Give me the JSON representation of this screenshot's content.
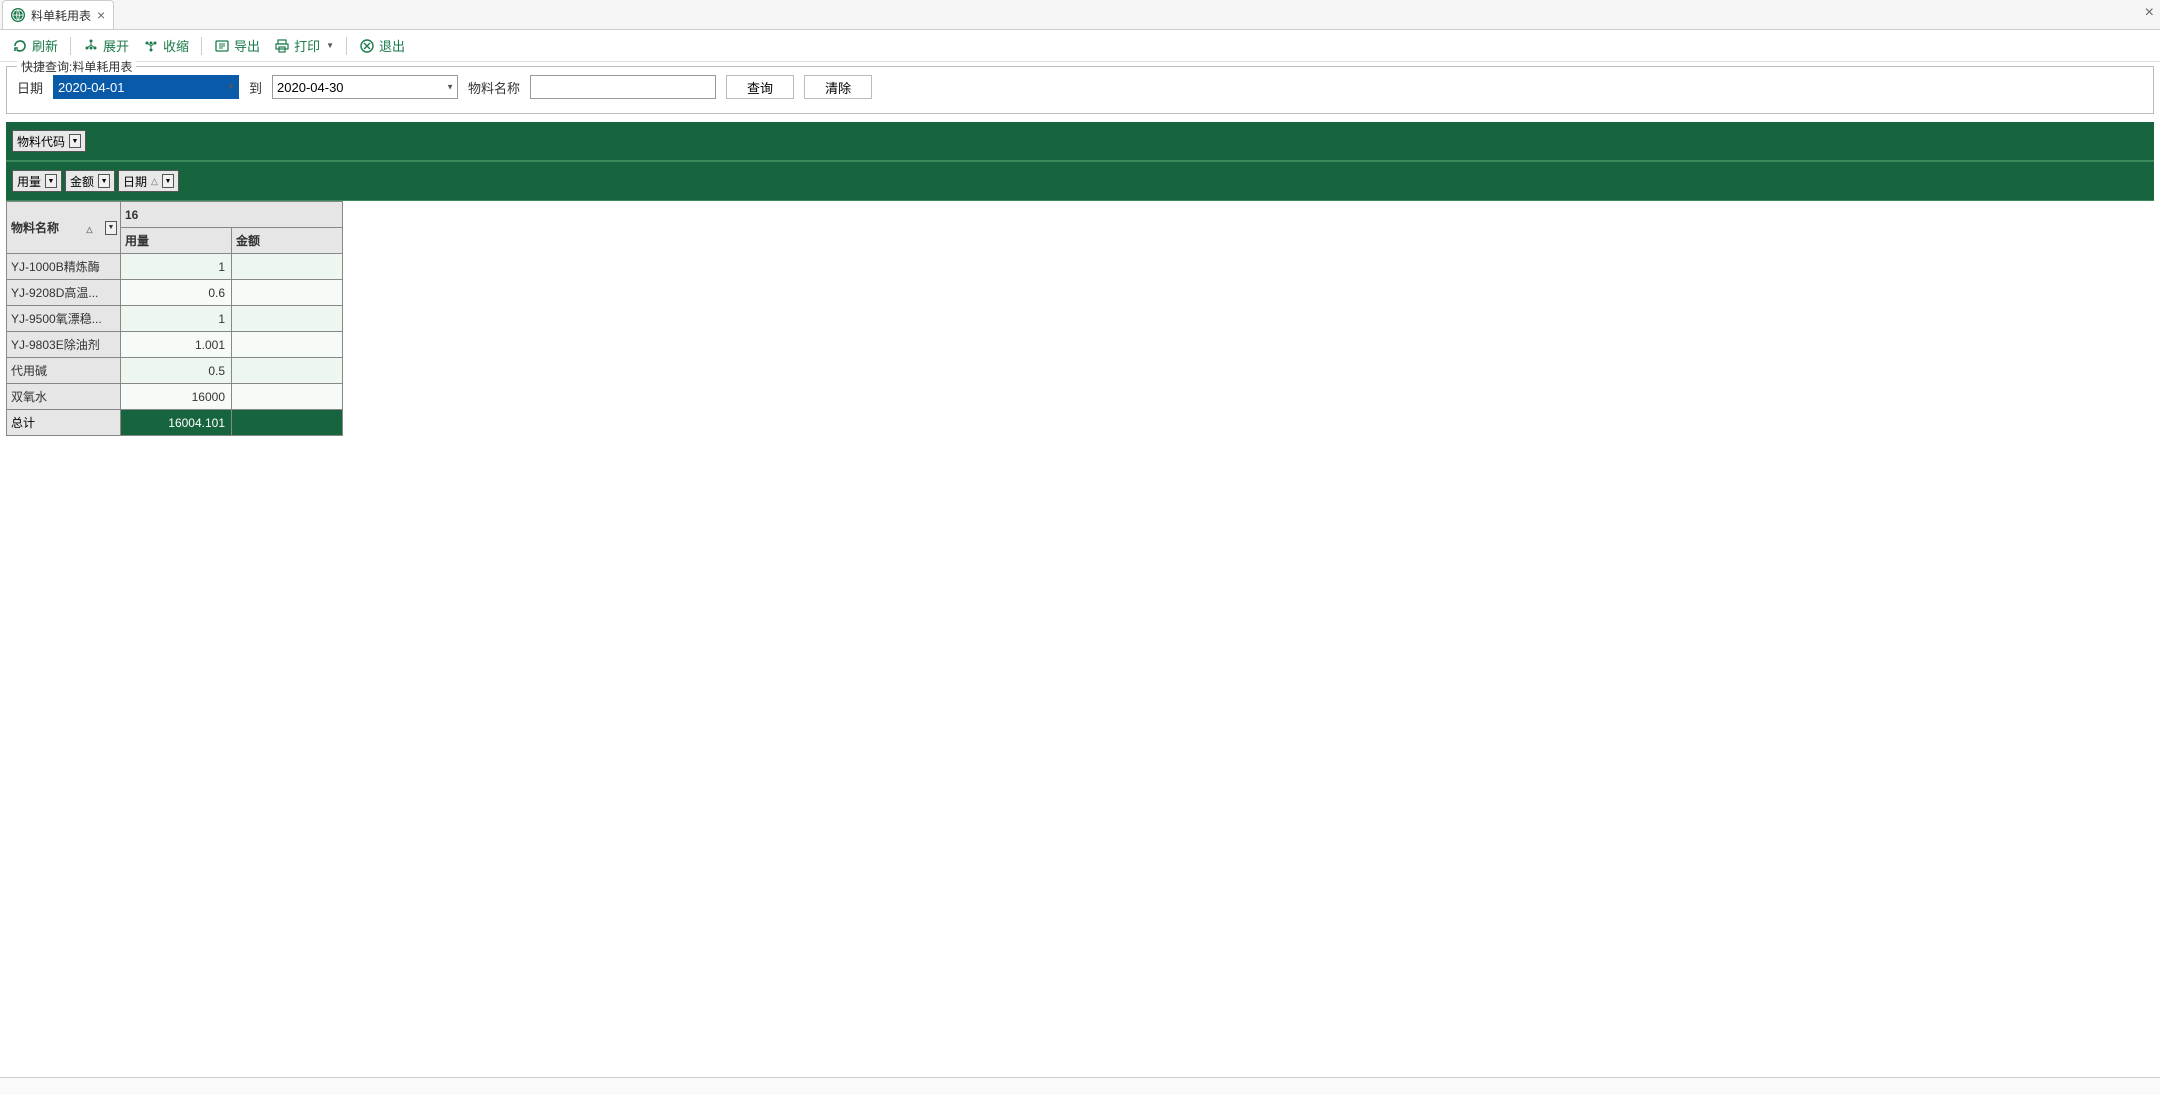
{
  "tab": {
    "title": "料单耗用表"
  },
  "toolbar": {
    "refresh": "刷新",
    "expand": "展开",
    "collapse": "收缩",
    "export": "导出",
    "print": "打印",
    "exit": "退出"
  },
  "filter": {
    "legend": "快捷查询:料单耗用表",
    "label_date": "日期",
    "date_from": "2020-04-01",
    "label_to": "到",
    "date_to": "2020-04-30",
    "label_material_name": "物料名称",
    "material_name_value": "",
    "btn_query": "查询",
    "btn_clear": "清除"
  },
  "pivot": {
    "col_drop": {
      "material_code": "物料代码"
    },
    "data_drop": {
      "usage": "用量",
      "amount": "金额",
      "date": "日期"
    },
    "row_header_label": "物料名称",
    "col_group_value": "16",
    "sub_cols": {
      "usage": "用量",
      "amount": "金额"
    },
    "rows": [
      {
        "name": "YJ-1000B精炼酶",
        "usage": "1",
        "amount": ""
      },
      {
        "name": "YJ-9208D高温...",
        "usage": "0.6",
        "amount": ""
      },
      {
        "name": "YJ-9500氧漂稳...",
        "usage": "1",
        "amount": ""
      },
      {
        "name": "YJ-9803E除油剂",
        "usage": "1.001",
        "amount": ""
      },
      {
        "name": "代用碱",
        "usage": "0.5",
        "amount": ""
      },
      {
        "name": "双氧水",
        "usage": "16000",
        "amount": ""
      }
    ],
    "total": {
      "label": "总计",
      "usage": "16004.101",
      "amount": ""
    }
  }
}
